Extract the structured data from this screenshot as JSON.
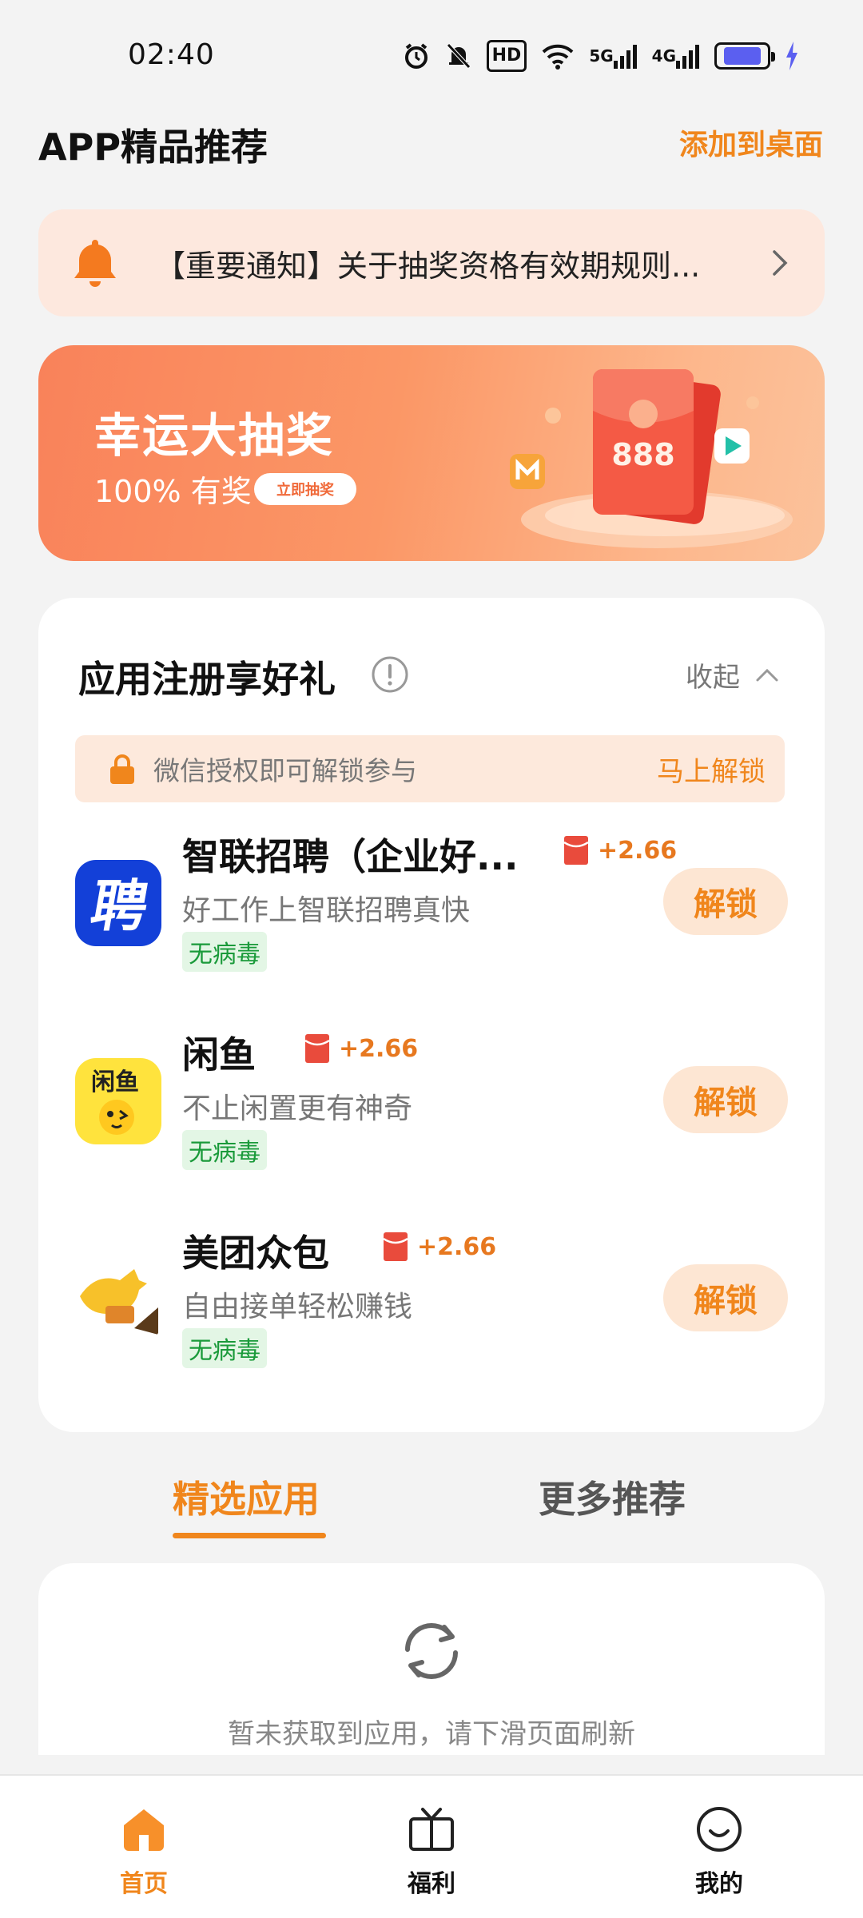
{
  "status_bar": {
    "time": "02:40",
    "hd_label": "HD",
    "net1": "5G",
    "net2": "4G",
    "battery_fraction": 0.8,
    "battery_color": "#5b5ff0"
  },
  "header": {
    "title": "APP精品推荐",
    "add_to_desktop": "添加到桌面"
  },
  "notice": {
    "text": "【重要通知】关于抽奖资格有效期规则..."
  },
  "banner": {
    "title": "幸运大抽奖",
    "subtitle": "100% 有奖",
    "button": "立即抽奖",
    "envelope_text": "888"
  },
  "register": {
    "title": "应用注册享好礼",
    "collapse_label": "收起",
    "unlock_hint": "微信授权即可解锁参与",
    "unlock_link": "马上解锁",
    "apps": [
      {
        "name": "智联招聘（企业好...",
        "reward": "+2.66",
        "desc": "好工作上智联招聘真快",
        "badge": "无病毒",
        "button": "解锁",
        "icon": "zhilian-icon"
      },
      {
        "name": "闲鱼",
        "reward": "+2.66",
        "desc": "不止闲置更有神奇",
        "badge": "无病毒",
        "button": "解锁",
        "icon": "xianyu-icon"
      },
      {
        "name": "美团众包",
        "reward": "+2.66",
        "desc": "自由接单轻松赚钱",
        "badge": "无病毒",
        "button": "解锁",
        "icon": "meituan-zhongbao-icon"
      }
    ]
  },
  "tabs": {
    "active": "精选应用",
    "inactive": "更多推荐"
  },
  "empty": {
    "text": "暂未获取到应用，请下滑页面刷新"
  },
  "bottom_nav": {
    "home": "首页",
    "welfare": "福利",
    "mine": "我的"
  },
  "colors": {
    "accent": "#f0861c",
    "banner_from": "#f9825a",
    "safe_green": "#1a9a3a"
  }
}
